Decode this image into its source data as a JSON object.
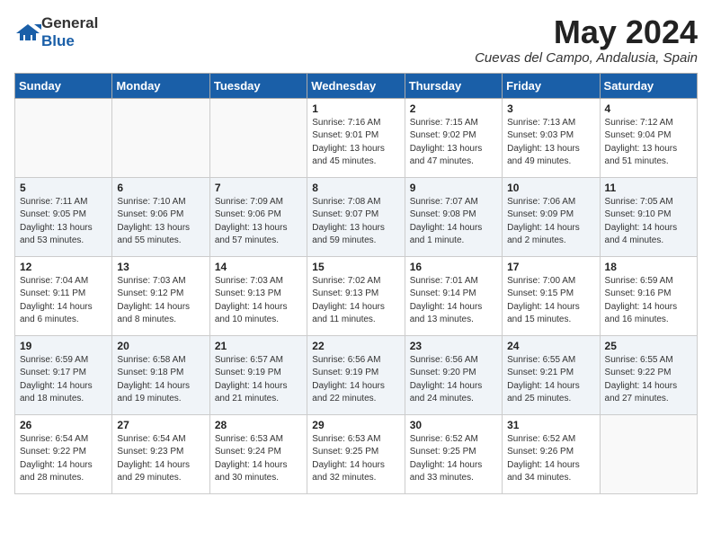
{
  "header": {
    "logo_general": "General",
    "logo_blue": "Blue",
    "title": "May 2024",
    "location": "Cuevas del Campo, Andalusia, Spain"
  },
  "weekdays": [
    "Sunday",
    "Monday",
    "Tuesday",
    "Wednesday",
    "Thursday",
    "Friday",
    "Saturday"
  ],
  "weeks": [
    [
      {
        "day": "",
        "info": ""
      },
      {
        "day": "",
        "info": ""
      },
      {
        "day": "",
        "info": ""
      },
      {
        "day": "1",
        "info": "Sunrise: 7:16 AM\nSunset: 9:01 PM\nDaylight: 13 hours\nand 45 minutes."
      },
      {
        "day": "2",
        "info": "Sunrise: 7:15 AM\nSunset: 9:02 PM\nDaylight: 13 hours\nand 47 minutes."
      },
      {
        "day": "3",
        "info": "Sunrise: 7:13 AM\nSunset: 9:03 PM\nDaylight: 13 hours\nand 49 minutes."
      },
      {
        "day": "4",
        "info": "Sunrise: 7:12 AM\nSunset: 9:04 PM\nDaylight: 13 hours\nand 51 minutes."
      }
    ],
    [
      {
        "day": "5",
        "info": "Sunrise: 7:11 AM\nSunset: 9:05 PM\nDaylight: 13 hours\nand 53 minutes."
      },
      {
        "day": "6",
        "info": "Sunrise: 7:10 AM\nSunset: 9:06 PM\nDaylight: 13 hours\nand 55 minutes."
      },
      {
        "day": "7",
        "info": "Sunrise: 7:09 AM\nSunset: 9:06 PM\nDaylight: 13 hours\nand 57 minutes."
      },
      {
        "day": "8",
        "info": "Sunrise: 7:08 AM\nSunset: 9:07 PM\nDaylight: 13 hours\nand 59 minutes."
      },
      {
        "day": "9",
        "info": "Sunrise: 7:07 AM\nSunset: 9:08 PM\nDaylight: 14 hours\nand 1 minute."
      },
      {
        "day": "10",
        "info": "Sunrise: 7:06 AM\nSunset: 9:09 PM\nDaylight: 14 hours\nand 2 minutes."
      },
      {
        "day": "11",
        "info": "Sunrise: 7:05 AM\nSunset: 9:10 PM\nDaylight: 14 hours\nand 4 minutes."
      }
    ],
    [
      {
        "day": "12",
        "info": "Sunrise: 7:04 AM\nSunset: 9:11 PM\nDaylight: 14 hours\nand 6 minutes."
      },
      {
        "day": "13",
        "info": "Sunrise: 7:03 AM\nSunset: 9:12 PM\nDaylight: 14 hours\nand 8 minutes."
      },
      {
        "day": "14",
        "info": "Sunrise: 7:03 AM\nSunset: 9:13 PM\nDaylight: 14 hours\nand 10 minutes."
      },
      {
        "day": "15",
        "info": "Sunrise: 7:02 AM\nSunset: 9:13 PM\nDaylight: 14 hours\nand 11 minutes."
      },
      {
        "day": "16",
        "info": "Sunrise: 7:01 AM\nSunset: 9:14 PM\nDaylight: 14 hours\nand 13 minutes."
      },
      {
        "day": "17",
        "info": "Sunrise: 7:00 AM\nSunset: 9:15 PM\nDaylight: 14 hours\nand 15 minutes."
      },
      {
        "day": "18",
        "info": "Sunrise: 6:59 AM\nSunset: 9:16 PM\nDaylight: 14 hours\nand 16 minutes."
      }
    ],
    [
      {
        "day": "19",
        "info": "Sunrise: 6:59 AM\nSunset: 9:17 PM\nDaylight: 14 hours\nand 18 minutes."
      },
      {
        "day": "20",
        "info": "Sunrise: 6:58 AM\nSunset: 9:18 PM\nDaylight: 14 hours\nand 19 minutes."
      },
      {
        "day": "21",
        "info": "Sunrise: 6:57 AM\nSunset: 9:19 PM\nDaylight: 14 hours\nand 21 minutes."
      },
      {
        "day": "22",
        "info": "Sunrise: 6:56 AM\nSunset: 9:19 PM\nDaylight: 14 hours\nand 22 minutes."
      },
      {
        "day": "23",
        "info": "Sunrise: 6:56 AM\nSunset: 9:20 PM\nDaylight: 14 hours\nand 24 minutes."
      },
      {
        "day": "24",
        "info": "Sunrise: 6:55 AM\nSunset: 9:21 PM\nDaylight: 14 hours\nand 25 minutes."
      },
      {
        "day": "25",
        "info": "Sunrise: 6:55 AM\nSunset: 9:22 PM\nDaylight: 14 hours\nand 27 minutes."
      }
    ],
    [
      {
        "day": "26",
        "info": "Sunrise: 6:54 AM\nSunset: 9:22 PM\nDaylight: 14 hours\nand 28 minutes."
      },
      {
        "day": "27",
        "info": "Sunrise: 6:54 AM\nSunset: 9:23 PM\nDaylight: 14 hours\nand 29 minutes."
      },
      {
        "day": "28",
        "info": "Sunrise: 6:53 AM\nSunset: 9:24 PM\nDaylight: 14 hours\nand 30 minutes."
      },
      {
        "day": "29",
        "info": "Sunrise: 6:53 AM\nSunset: 9:25 PM\nDaylight: 14 hours\nand 32 minutes."
      },
      {
        "day": "30",
        "info": "Sunrise: 6:52 AM\nSunset: 9:25 PM\nDaylight: 14 hours\nand 33 minutes."
      },
      {
        "day": "31",
        "info": "Sunrise: 6:52 AM\nSunset: 9:26 PM\nDaylight: 14 hours\nand 34 minutes."
      },
      {
        "day": "",
        "info": ""
      }
    ]
  ]
}
